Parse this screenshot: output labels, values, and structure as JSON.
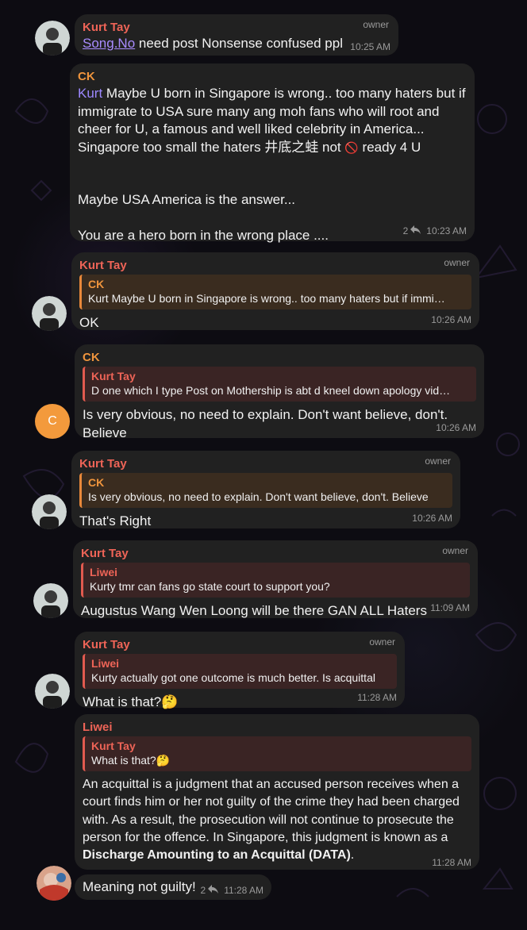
{
  "colors": {
    "background": "#0d0c12",
    "bubble": "#212121",
    "kurt_name": "#ee6457",
    "ck_name": "#f0953d",
    "mention": "#9d88ff",
    "ck_avatar": "#f39a3c"
  },
  "messages": [
    {
      "sender": "Kurt Tay",
      "badge": "owner",
      "mention": "Song.No",
      "text": " need post Nonsense confused ppl",
      "time": "10:25 AM"
    },
    {
      "sender": "CK",
      "mention": "Kurt",
      "text1": "  Maybe U born in Singapore is wrong.. too many haters but if immigrate to USA sure many ang moh fans who will root and cheer for U, a famous and well liked celebrity in America... Singapore too small the haters 井底之蛙 not ",
      "emoji": "🚫",
      "text1b": "  ready 4 U",
      "text2": "Maybe USA America is the answer...",
      "text3": "You are a hero born in the wrong place ....",
      "replies": "2",
      "time": "10:23 AM"
    },
    {
      "sender": "Kurt Tay",
      "badge": "owner",
      "reply_sender": "CK",
      "reply_text": "Kurt Maybe U born in Singapore is wrong.. too many haters but if immi…",
      "text": "OK",
      "time": "10:26 AM"
    },
    {
      "sender": "CK",
      "avatar_letter": "C",
      "reply_sender": "Kurt Tay",
      "reply_text": "D one which I type Post on Mothership is abt d kneel down apology vid…",
      "text": "Is very obvious, no need to explain. Don't want believe, don't. Believe",
      "time": "10:26 AM"
    },
    {
      "sender": "Kurt Tay",
      "badge": "owner",
      "reply_sender": "CK",
      "reply_text": "Is very obvious, no need to explain. Don't want believe, don't. Believe",
      "text": "That's Right",
      "time": "10:26 AM"
    },
    {
      "sender": "Kurt Tay",
      "badge": "owner",
      "reply_sender": "Liwei",
      "reply_text": "Kurty tmr can fans go state court to support you?",
      "text": "Augustus Wang Wen Loong will be there GAN ALL Haters",
      "time": "11:09 AM"
    },
    {
      "sender": "Kurt Tay",
      "badge": "owner",
      "reply_sender": "Liwei",
      "reply_text": "Kurty actually got one outcome is much better. Is acquittal",
      "text": "What is that?🤔",
      "time": "11:28 AM"
    },
    {
      "sender": "Liwei",
      "reply_sender": "Kurt Tay",
      "reply_text": "What is that?🤔",
      "text": "An acquittal is a judgment that an accused person receives when a court finds him or her not guilty of the crime they had been charged with. As a result, the prosecution will not continue to prosecute the person for the offence. In Singapore, this judgment is known as a ",
      "text_bold": "Discharge Amounting to an Acquittal (DATA)",
      "text_end": ".",
      "time": "11:28 AM"
    },
    {
      "text": "Meaning not guilty!",
      "replies": "2",
      "time": "11:28 AM"
    }
  ]
}
